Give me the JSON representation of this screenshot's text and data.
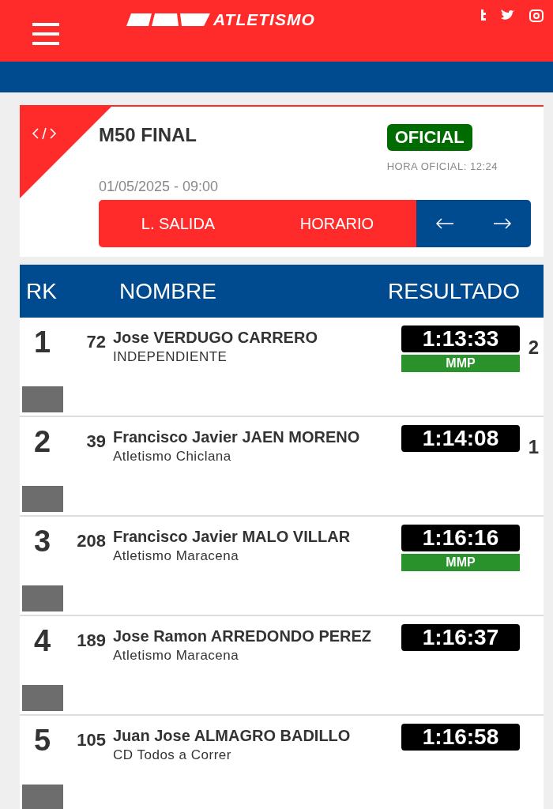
{
  "header": {
    "logo": "ATLETISMO"
  },
  "event": {
    "title": "M50 FINAL",
    "status": "OFICIAL",
    "official_time": "HORA OFICIAL: 12:24",
    "datetime": "01/05/2025 - 09:00",
    "buttons": [
      "L. SALIDA",
      "HORARIO"
    ]
  },
  "table": {
    "columns": [
      "RK",
      "NOMBRE",
      "RESULTADO"
    ],
    "rows": [
      {
        "rank": "1",
        "bib": "72",
        "name": "Jose VERDUGO CARRERO",
        "club": "INDEPENDIENTE",
        "time": "1:13:33",
        "badge": "MMP",
        "extra": "2"
      },
      {
        "rank": "2",
        "bib": "39",
        "name": "Francisco Javier JAEN MORENO",
        "club": "Atletismo Chiclana",
        "time": "1:14:08",
        "extra": "1"
      },
      {
        "rank": "3",
        "bib": "208",
        "name": "Francisco Javier MALO VILLAR",
        "club": "Atletismo Maracena",
        "time": "1:16:16",
        "badge": "MMP"
      },
      {
        "rank": "4",
        "bib": "189",
        "name": "Jose Ramon ARREDONDO PEREZ",
        "club": "Atletismo Maracena",
        "time": "1:16:37"
      },
      {
        "rank": "5",
        "bib": "105",
        "name": "Juan Jose ALMAGRO BADILLO",
        "club": "CD Todos a Correr",
        "time": "1:16:58"
      }
    ]
  }
}
